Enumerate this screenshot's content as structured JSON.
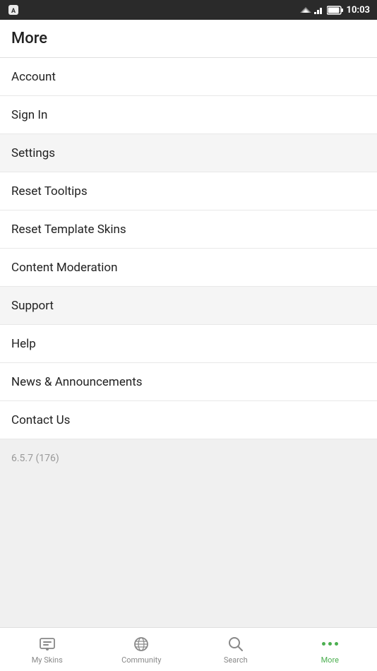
{
  "statusBar": {
    "time": "10:03"
  },
  "header": {
    "title": "More"
  },
  "menuItems": [
    {
      "id": "account",
      "label": "Account",
      "shaded": false
    },
    {
      "id": "sign-in",
      "label": "Sign In",
      "shaded": false
    },
    {
      "id": "settings",
      "label": "Settings",
      "shaded": true
    },
    {
      "id": "reset-tooltips",
      "label": "Reset Tooltips",
      "shaded": false
    },
    {
      "id": "reset-template-skins",
      "label": "Reset Template Skins",
      "shaded": false
    },
    {
      "id": "content-moderation",
      "label": "Content Moderation",
      "shaded": false
    },
    {
      "id": "support",
      "label": "Support",
      "shaded": true
    },
    {
      "id": "help",
      "label": "Help",
      "shaded": false
    },
    {
      "id": "news-announcements",
      "label": "News & Announcements",
      "shaded": false
    },
    {
      "id": "contact-us",
      "label": "Contact Us",
      "shaded": false
    }
  ],
  "version": {
    "text": "6.5.7 (176)"
  },
  "bottomNav": {
    "items": [
      {
        "id": "my-skins",
        "label": "My Skins",
        "active": false
      },
      {
        "id": "community",
        "label": "Community",
        "active": false
      },
      {
        "id": "search",
        "label": "Search",
        "active": false
      },
      {
        "id": "more",
        "label": "More",
        "active": true
      }
    ]
  }
}
